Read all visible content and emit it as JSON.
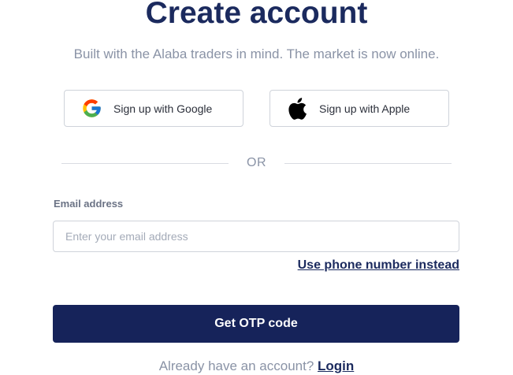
{
  "header": {
    "title": "Create account",
    "subtitle": "Built with the Alaba traders in mind. The market is now online."
  },
  "social": {
    "google": {
      "label": "Sign up with Google",
      "icon": "google-icon"
    },
    "apple": {
      "label": "Sign up with Apple",
      "icon": "apple-icon"
    }
  },
  "divider": {
    "text": "OR"
  },
  "email": {
    "label": "Email address",
    "placeholder": "Enter your email address",
    "value": ""
  },
  "phone_link": "Use phone number instead",
  "submit": {
    "label": "Get OTP code"
  },
  "footer": {
    "prompt": "Already have an account?",
    "login_label": "Login"
  },
  "colors": {
    "primary": "#16235a",
    "muted_text": "#8a93a6",
    "border": "#cfd3da"
  }
}
